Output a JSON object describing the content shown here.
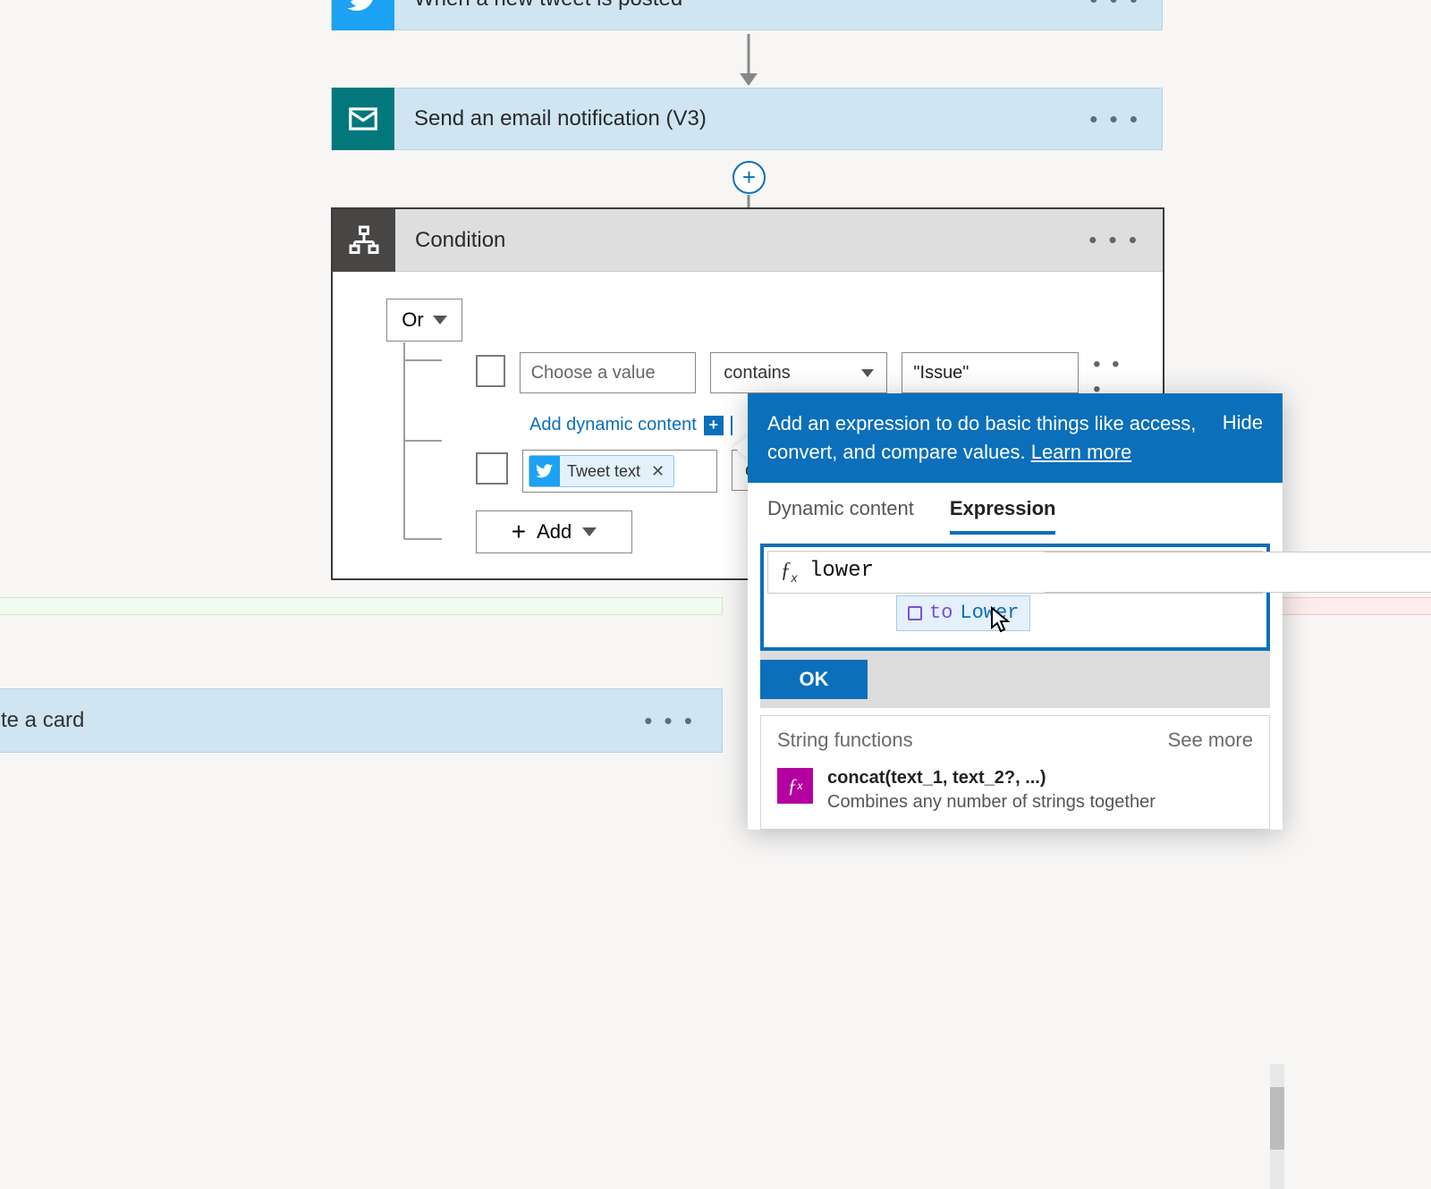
{
  "flow": {
    "step1": {
      "title": "When a new tweet is posted"
    },
    "step2": {
      "title": "Send an email notification (V3)"
    }
  },
  "condition": {
    "title": "Condition",
    "group_op": "Or",
    "rows": [
      {
        "value_placeholder": "Choose a value",
        "operator": "contains",
        "compare": "\"Issue\""
      },
      {
        "chip_label": "Tweet text",
        "operator": "conta"
      }
    ],
    "add_dynamic": "Add dynamic content",
    "add_button": "Add"
  },
  "flyout": {
    "message": "Add an expression to do basic things like access, convert, and compare values. ",
    "learn": "Learn more",
    "hide": "Hide",
    "tabs": {
      "dynamic": "Dynamic content",
      "expression": "Expression"
    },
    "expr_text": "lower",
    "autocomplete": {
      "prefix": "to",
      "match": "Lower"
    },
    "ok": "OK",
    "functions": {
      "group_title": "String functions",
      "see_more": "See more",
      "items": [
        {
          "sig": "concat(text_1, text_2?, ...)",
          "desc": "Combines any number of strings together"
        }
      ]
    }
  },
  "partial_card": {
    "title": "te a card"
  }
}
